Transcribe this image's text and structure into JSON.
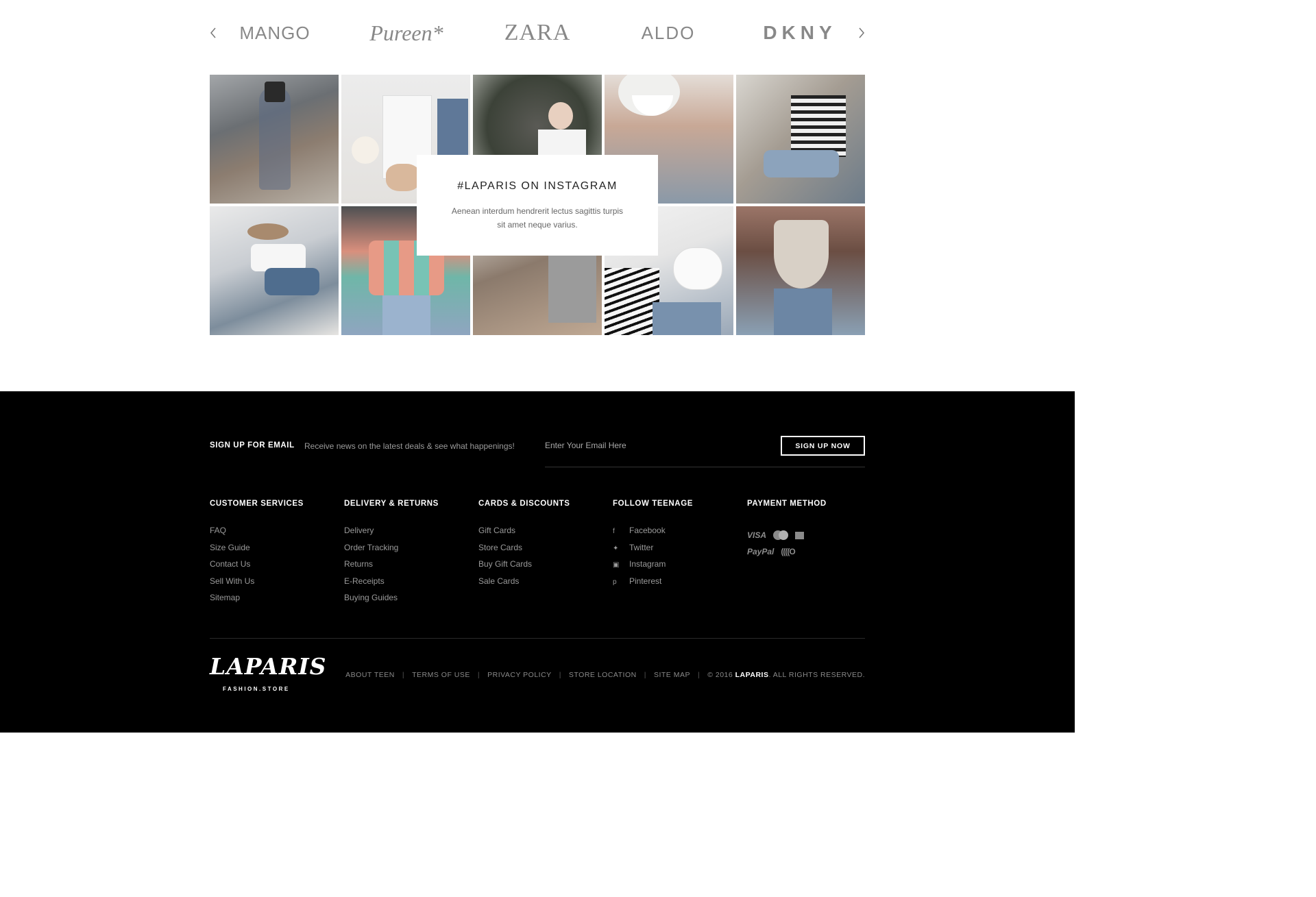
{
  "brands": {
    "items": [
      "MANGO",
      "Pureen*",
      "ZARA",
      "ALDO",
      "DKNY"
    ]
  },
  "instagram": {
    "title": "#LAPARIS ON INSTAGRAM",
    "description": "Aenean interdum hendrerit lectus sagittis turpis sit amet neque varius."
  },
  "signup": {
    "title": "SIGN UP FOR EMAIL",
    "description": "Receive news on the latest deals & see what happenings!",
    "placeholder": "Enter Your Email Here",
    "button": "SIGN UP NOW"
  },
  "footer": {
    "customer_services": {
      "title": "CUSTOMER SERVICES",
      "items": [
        "FAQ",
        "Size Guide",
        "Contact Us",
        "Sell With Us",
        "Sitemap"
      ]
    },
    "delivery_returns": {
      "title": "DELIVERY & RETURNS",
      "items": [
        "Delivery",
        "Order Tracking",
        "Returns",
        "E-Receipts",
        "Buying Guides"
      ]
    },
    "cards_discounts": {
      "title": "CARDS & DISCOUNTS",
      "items": [
        "Gift Cards",
        "Store Cards",
        "Buy Gift Cards",
        "Sale Cards"
      ]
    },
    "follow": {
      "title": "FOLLOW TEENAGE",
      "items": [
        {
          "label": "Facebook",
          "icon": "facebook-icon"
        },
        {
          "label": "Twitter",
          "icon": "twitter-icon"
        },
        {
          "label": "Instagram",
          "icon": "instagram-icon"
        },
        {
          "label": "Pinterest",
          "icon": "pinterest-icon"
        }
      ]
    },
    "payment": {
      "title": "PAYMENT METHOD",
      "methods": [
        "VISA",
        "MasterCard",
        "American Express",
        "PayPal",
        "Contactless"
      ]
    }
  },
  "bottom": {
    "logo": "LAPARIS",
    "logo_sub": "FASHION.STORE",
    "links": [
      "ABOUT TEEN",
      "TERMS OF USE",
      "PRIVACY POLICY",
      "STORE LOCATION",
      "SITE MAP"
    ],
    "copyright_prefix": "© 2016",
    "copyright_brand": "LAPARIS",
    "copyright_suffix": ". ALL RIGHTS RESERVED."
  },
  "colors": {
    "footer_bg": "#000000",
    "text_muted": "#9a9a9a",
    "text_light": "#ffffff"
  }
}
